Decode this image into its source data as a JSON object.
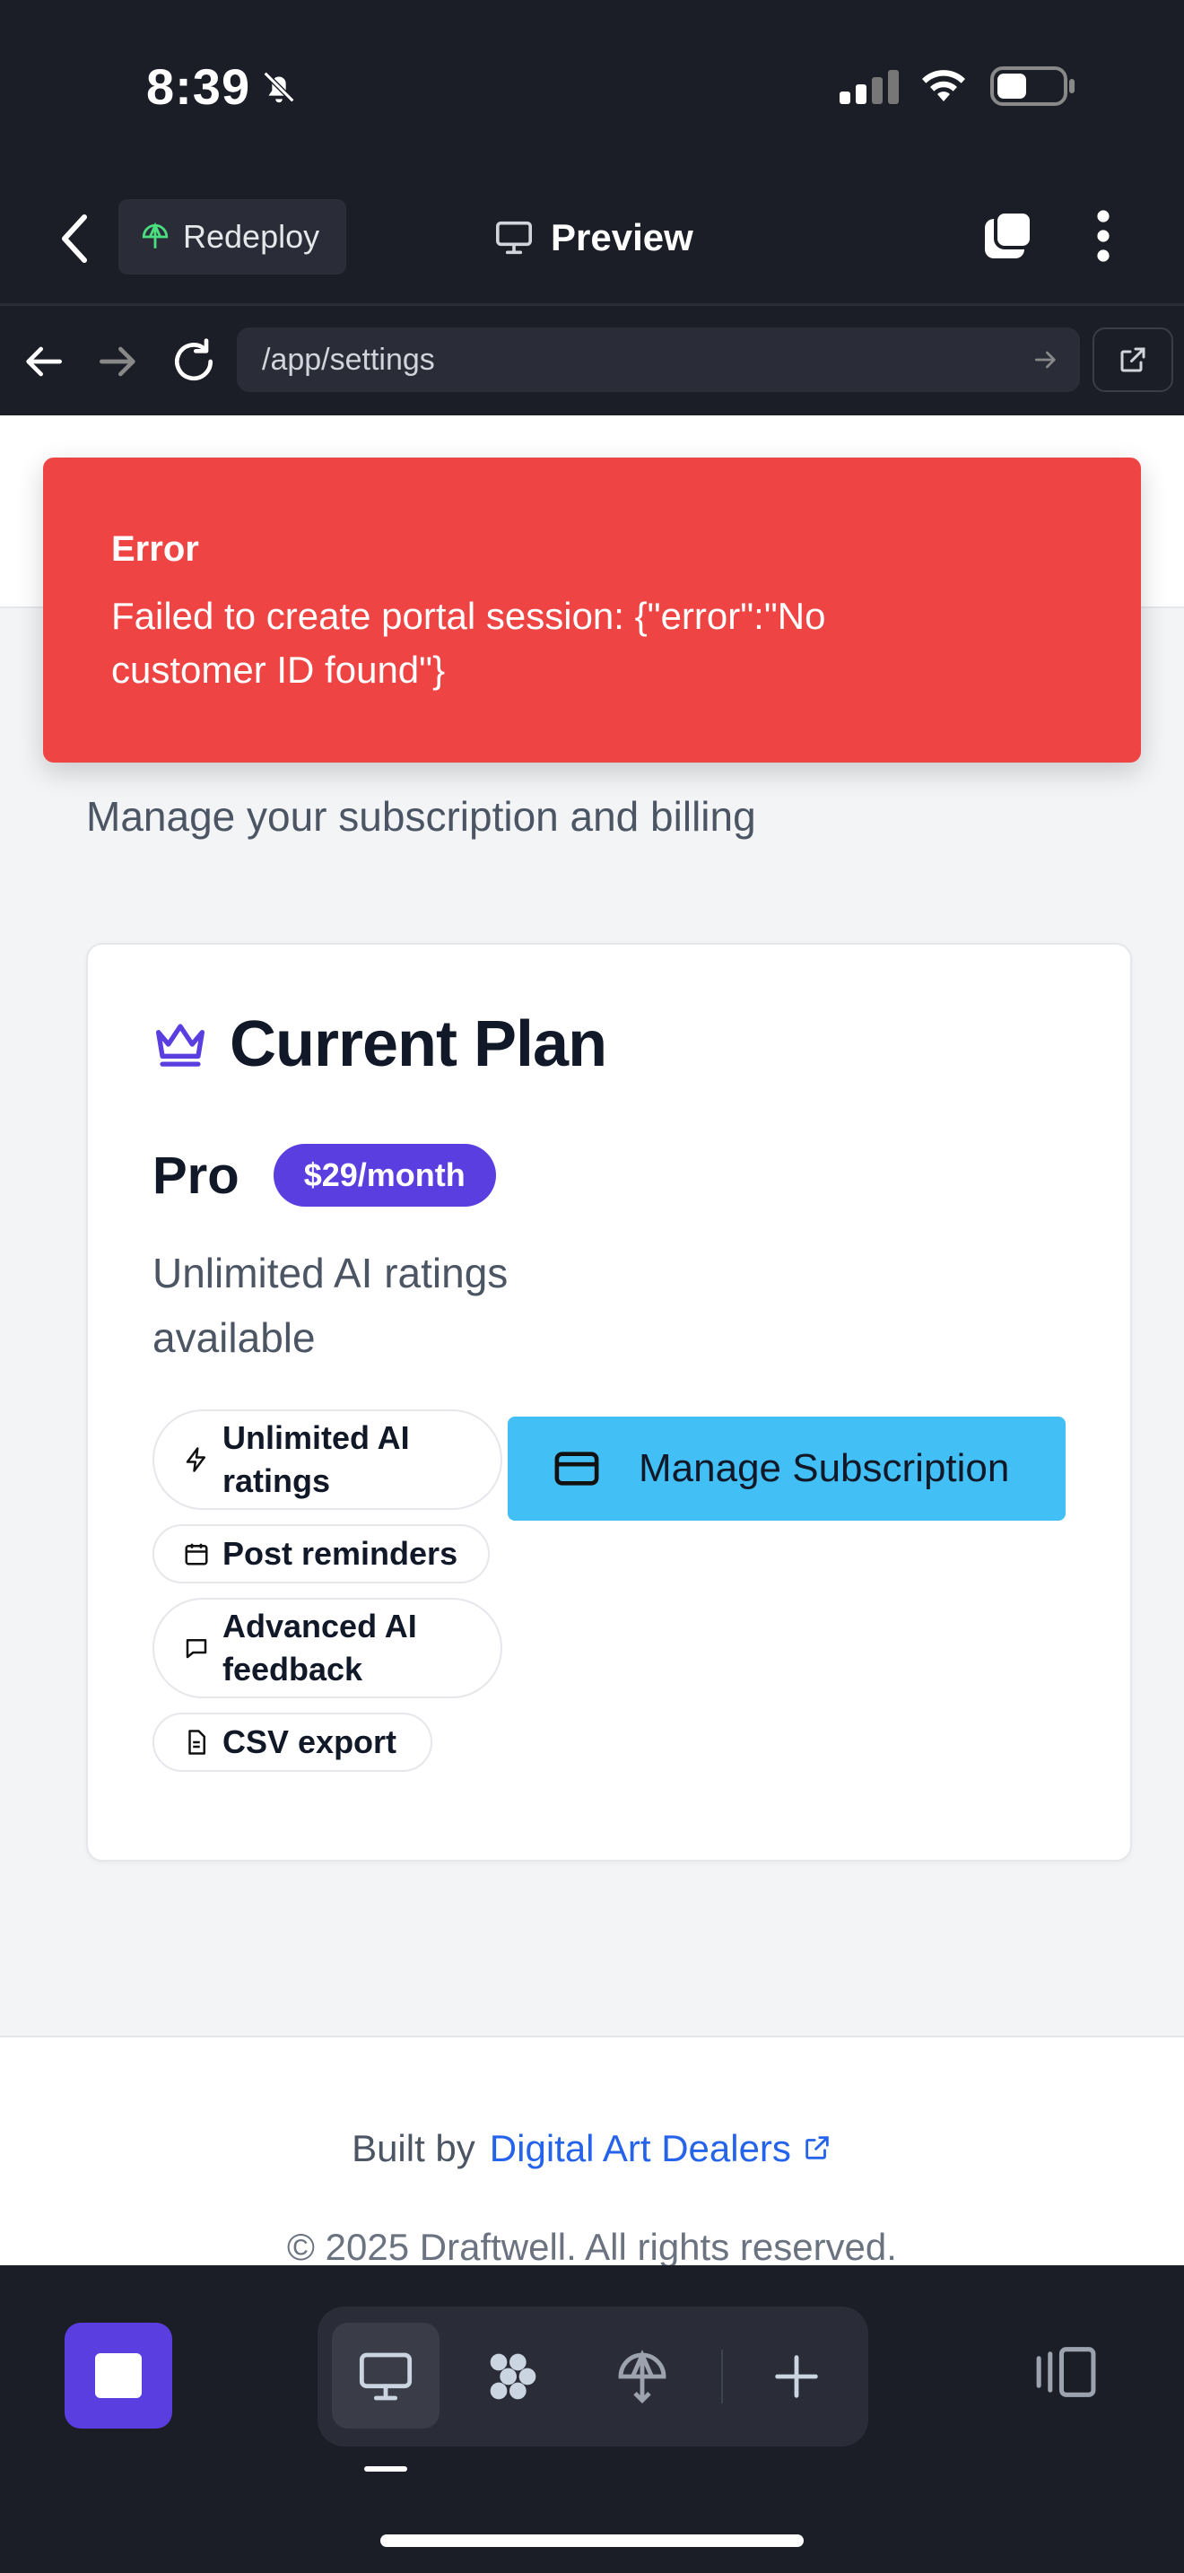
{
  "status_bar": {
    "time": "8:39"
  },
  "top_nav": {
    "redeploy_label": "Redeploy",
    "preview_label": "Preview"
  },
  "url_bar": {
    "url": "/app/settings"
  },
  "toast": {
    "title": "Error",
    "message": "Failed to create portal session: {\"error\":\"No customer ID found\"}"
  },
  "page": {
    "subtitle": "Manage your subscription and billing",
    "card": {
      "title": "Current Plan",
      "plan_name": "Pro",
      "price": "$29/month",
      "description": "Unlimited AI ratings available",
      "features": [
        {
          "label": "Unlimited AI ratings",
          "icon": "lightning-icon"
        },
        {
          "label": "Post reminders",
          "icon": "calendar-icon"
        },
        {
          "label": "Advanced AI feedback",
          "icon": "message-icon"
        },
        {
          "label": "CSV export",
          "icon": "file-icon"
        }
      ],
      "manage_button": "Manage Subscription"
    }
  },
  "footer": {
    "built_by": "Built by",
    "company": "Digital Art Dealers",
    "copyright": "© 2025 Draftwell. All rights reserved."
  },
  "colors": {
    "accent_purple": "#5b3ee0",
    "error_red": "#ef4444",
    "button_blue": "#42bff5",
    "link_blue": "#2563eb"
  }
}
